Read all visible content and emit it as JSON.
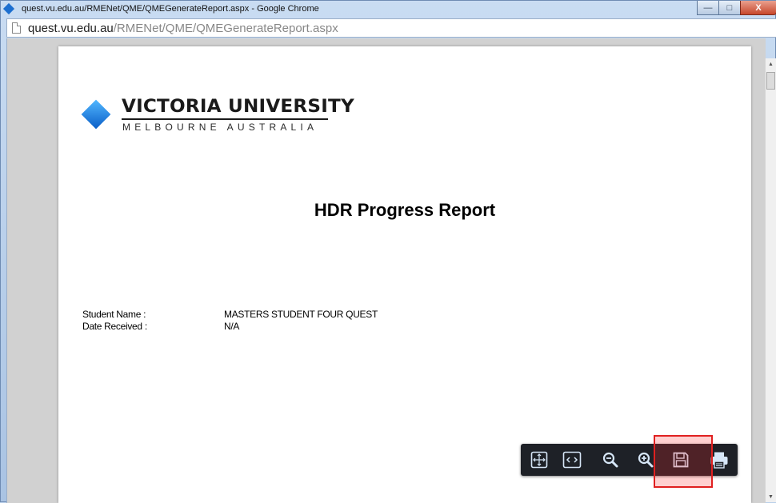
{
  "window": {
    "title": "quest.vu.edu.au/RMENet/QME/QMEGenerateReport.aspx - Google Chrome",
    "minimize_glyph": "—",
    "maximize_glyph": "□",
    "close_glyph": "X"
  },
  "address_bar": {
    "host": "quest.vu.edu.au",
    "path": "/RMENet/QME/QMEGenerateReport.aspx"
  },
  "logo": {
    "name": "VICTORIA UNIVERSITY",
    "subtitle": "MELBOURNE AUSTRALIA",
    "accent_color": "#1a7be0"
  },
  "report": {
    "title": "HDR Progress Report",
    "fields": [
      {
        "label": "Student Name :",
        "value": "MASTERS STUDENT FOUR QUEST"
      },
      {
        "label": "Date Received :",
        "value": "N/A"
      }
    ]
  },
  "toolbar": {
    "buttons": [
      {
        "icon": "fit-page-icon"
      },
      {
        "icon": "fit-width-icon"
      },
      {
        "icon": "zoom-out-icon"
      },
      {
        "icon": "zoom-in-icon"
      },
      {
        "icon": "save-icon",
        "highlighted": true
      },
      {
        "icon": "print-icon"
      }
    ],
    "highlight_color": "#e02020"
  }
}
